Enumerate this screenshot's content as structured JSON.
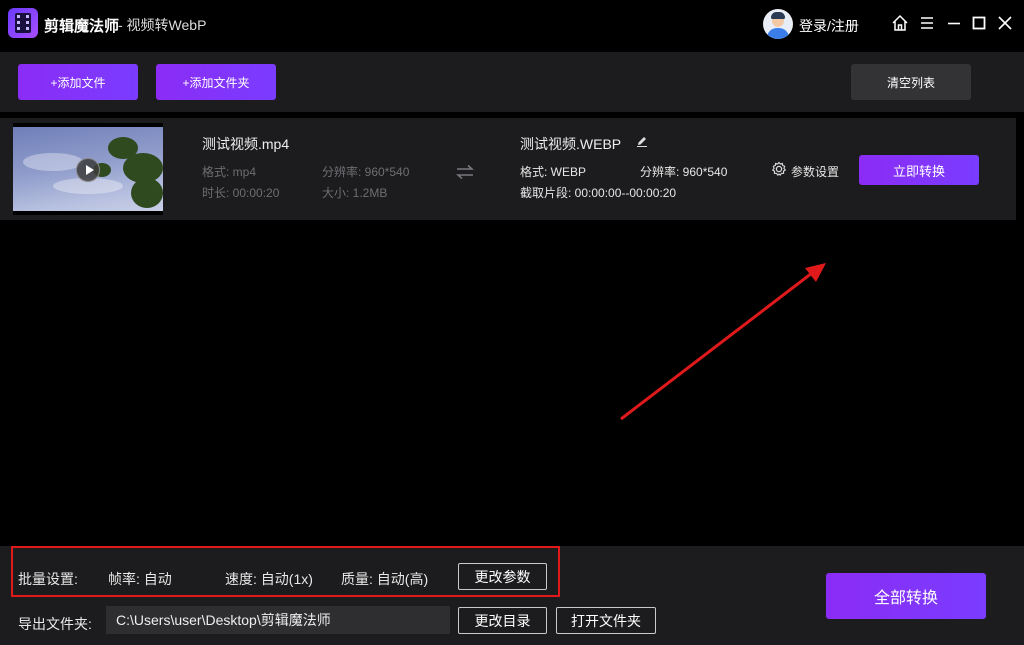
{
  "titlebar": {
    "app_name": "剪辑魔法师",
    "subtitle": "- 视频转WebP",
    "login_label": "登录/注册",
    "icons": [
      "home-icon",
      "menu-icon",
      "minimize-icon",
      "maximize-icon",
      "close-icon"
    ]
  },
  "toolbar": {
    "add_file_label": "+添加文件",
    "add_folder_label": "+添加文件夹",
    "clear_list_label": "清空列表"
  },
  "file_item": {
    "source": {
      "name": "测试视频.mp4",
      "format_label": "格式: mp4",
      "resolution_label": "分辨率: 960*540",
      "duration_label": "时长: 00:00:20",
      "size_label": "大小: 1.2MB"
    },
    "output": {
      "name": "测试视频.WEBP",
      "format_label": "格式: WEBP",
      "resolution_label": "分辨率: 960*540",
      "clip_label": "截取片段: 00:00:00--00:00:20"
    },
    "settings_label": "参数设置",
    "convert_now_label": "立即转换"
  },
  "batch": {
    "title": "批量设置:",
    "framerate_label": "帧率: 自动",
    "speed_label": "速度: 自动(1x)",
    "quality_label": "质量: 自动(高)",
    "change_params_label": "更改参数"
  },
  "output_folder": {
    "label": "导出文件夹:",
    "path": "C:\\Users\\user\\Desktop\\剪辑魔法师",
    "change_dir_label": "更改目录",
    "open_folder_label": "打开文件夹"
  },
  "convert_all_label": "全部转换",
  "colors": {
    "accent_start": "#8b2cf5",
    "accent_end": "#7a3cff",
    "annotation_red": "#e0191b",
    "panel_bg": "#1c1c1e"
  }
}
